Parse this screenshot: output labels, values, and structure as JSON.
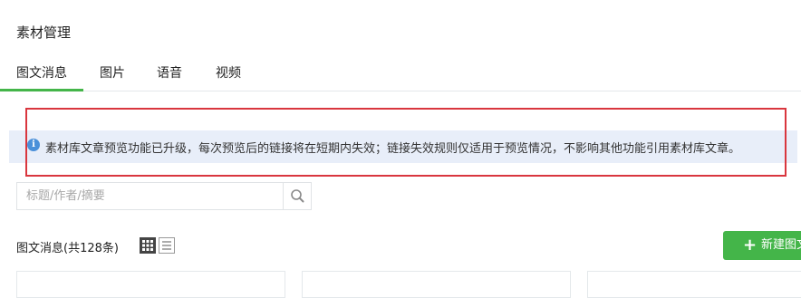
{
  "page": {
    "title": "素材管理"
  },
  "tabs": [
    {
      "label": "图文消息",
      "active": true
    },
    {
      "label": "图片",
      "active": false
    },
    {
      "label": "语音",
      "active": false
    },
    {
      "label": "视频",
      "active": false
    }
  ],
  "notice": {
    "icon": "info-icon",
    "text": "素材库文章预览功能已升级，每次预览后的链接将在短期内失效；链接失效规则仅适用于预览情况，不影响其他功能引用素材库文章。"
  },
  "search": {
    "placeholder": "标题/作者/摘要",
    "value": "",
    "icon": "search-icon"
  },
  "list": {
    "label": "图文消息(共128条)",
    "view_modes": [
      "grid-view-icon",
      "list-view-icon"
    ]
  },
  "new_button": {
    "label": "新建图文"
  },
  "colors": {
    "accent": "#44b549",
    "notice_bg": "#e8eef9",
    "highlight": "#d9363e"
  }
}
